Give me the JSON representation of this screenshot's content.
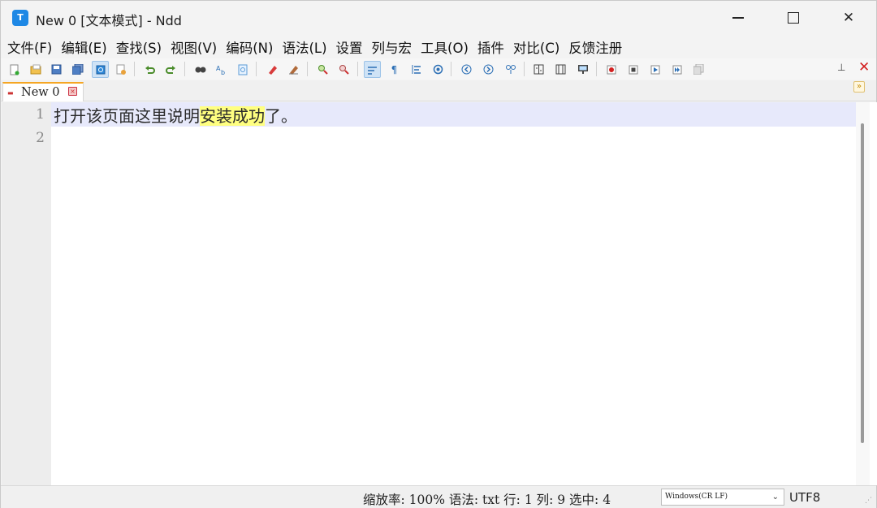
{
  "window": {
    "title": "New 0 [文本模式] - Ndd",
    "app_icon_letter": "T"
  },
  "menu": [
    "文件(F)",
    "编辑(E)",
    "查找(S)",
    "视图(V)",
    "编码(N)",
    "语法(L)",
    "设置",
    "列与宏",
    "工具(O)",
    "插件",
    "对比(C)",
    "反馈注册"
  ],
  "toolbar": {
    "icons": [
      "new-file-icon",
      "open-file-icon",
      "save-icon",
      "save-all-icon",
      "close-file-icon",
      "close-all-icon",
      "undo-icon",
      "redo-icon",
      "find-icon",
      "replace-icon",
      "find-in-files-icon",
      "mark-icon",
      "clear-mark-icon",
      "zoom-in-icon",
      "zoom-out-icon",
      "word-wrap-icon",
      "show-all-chars-icon",
      "indent-guide-icon",
      "focus-icon",
      "prev-icon",
      "next-icon",
      "link-icon",
      "compare-icon",
      "compare-dir-icon",
      "monitor-icon",
      "record-macro-icon",
      "stop-macro-icon",
      "play-macro-icon",
      "run-macro-multiple-icon",
      "save-macro-icon"
    ]
  },
  "tabs": [
    {
      "label": "New  0"
    }
  ],
  "editor": {
    "line_numbers": [
      "1",
      "2"
    ],
    "line1_before": "打开该页面这里说明",
    "line1_highlight": "安装成功",
    "line1_after": "了。",
    "line2": ""
  },
  "status": {
    "text": "缩放率: 100% 语法: txt 行: 1  列: 9  选中: 4",
    "eol": "Windows(CR LF)",
    "encoding": "UTF8"
  },
  "colors": {
    "app_icon": "#1e88e5",
    "current_line": "#e7e9fb",
    "highlight": "#ffff80",
    "tab_accent": "#f5a623",
    "close_red": "#d32020"
  }
}
